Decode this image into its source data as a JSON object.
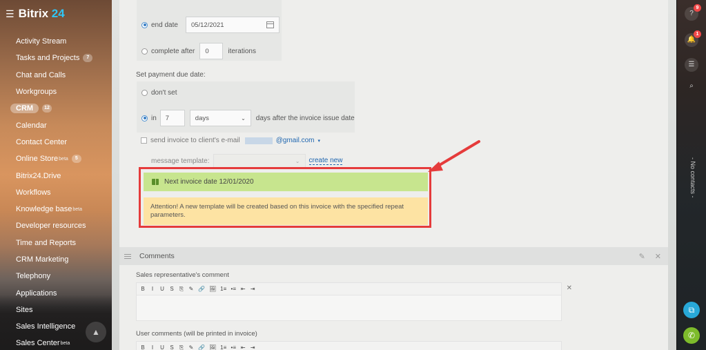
{
  "app": {
    "logo_text": "Bitrix",
    "logo_number": "24"
  },
  "sidebar": {
    "items": [
      {
        "label": "Activity Stream",
        "count": ""
      },
      {
        "label": "Tasks and Projects",
        "count": "7"
      },
      {
        "label": "Chat and Calls",
        "count": ""
      },
      {
        "label": "Workgroups",
        "count": ""
      },
      {
        "label": "CRM",
        "count": "12"
      },
      {
        "label": "Calendar",
        "count": ""
      },
      {
        "label": "Contact Center",
        "count": ""
      },
      {
        "label": "Online Store",
        "sup": "beta",
        "count": "5"
      },
      {
        "label": "Bitrix24.Drive",
        "count": ""
      },
      {
        "label": "Workflows",
        "count": ""
      },
      {
        "label": "Knowledge base",
        "sup": "beta",
        "count": ""
      },
      {
        "label": "Developer resources",
        "count": ""
      },
      {
        "label": "Time and Reports",
        "count": ""
      },
      {
        "label": "CRM Marketing",
        "count": ""
      },
      {
        "label": "Telephony",
        "count": ""
      },
      {
        "label": "Applications",
        "count": ""
      },
      {
        "label": "Sites",
        "count": ""
      },
      {
        "label": "Sales Intelligence",
        "count": ""
      },
      {
        "label": "Sales Center",
        "sup": "beta",
        "count": ""
      }
    ],
    "active_item": "CRM"
  },
  "form": {
    "end_date_label": "end date",
    "end_date_value": "05/12/2021",
    "complete_after_label": "complete after",
    "complete_after_value": "0",
    "iterations_label": "iterations",
    "payment_due_heading": "Set payment due date:",
    "dont_set_label": "don't set",
    "in_label": "in",
    "in_value": "7",
    "period_select": "days",
    "after_issue_label": "days after the invoice issue date",
    "send_invoice_label": "send invoice to client's e-mail",
    "email_domain": "@gmail.com",
    "message_template_label": "message template:",
    "create_new_label": "create new",
    "next_invoice_text": "Next invoice date 12/01/2020",
    "attention_text": "Attention! A new template will be created based on this invoice with the specified repeat parameters."
  },
  "comments": {
    "section_title": "Comments",
    "sales_rep_label": "Sales representative's comment",
    "user_comments_label": "User comments (will be printed in invoice)",
    "toolbar_buttons": [
      "B",
      "I",
      "U",
      "S",
      "⎘",
      "✎",
      "🔗",
      "🖼",
      "1≡",
      "•≡",
      "⇤",
      "⇥"
    ]
  },
  "rightbar": {
    "help_badge": "9",
    "notifications_badge": "1",
    "no_contacts_label": "- No contacts -"
  },
  "colors": {
    "accent_blue": "#2067b0",
    "highlight_red": "#e53b3b",
    "success_green": "#c7e58e",
    "warning_yellow": "#fde3a3",
    "logo_blue": "#2fc6f6"
  }
}
